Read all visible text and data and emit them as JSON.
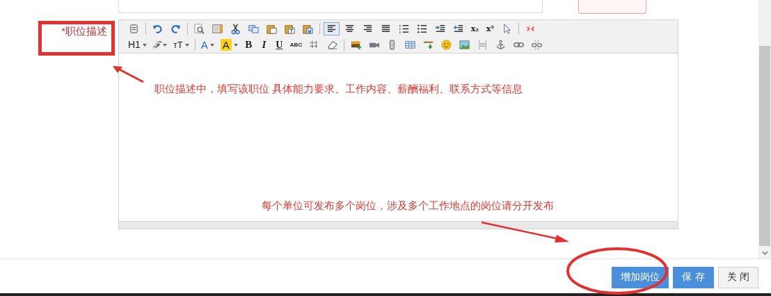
{
  "form": {
    "label": "*职位描述",
    "editor": {
      "toolbar": [
        [
          {
            "kind": "icon",
            "active": false
          },
          {
            "kind": "separator"
          },
          {
            "kind": "icon",
            "active": false
          },
          {
            "kind": "icon",
            "active": false
          },
          {
            "kind": "separator"
          },
          {
            "kind": "icon",
            "active": false
          },
          {
            "kind": "icon",
            "active": false
          },
          {
            "kind": "icon",
            "active": false
          },
          {
            "kind": "icon",
            "active": false
          },
          {
            "kind": "icon",
            "active": false
          },
          {
            "kind": "icon",
            "active": false
          },
          {
            "kind": "icon",
            "active": false
          },
          {
            "kind": "separator"
          },
          {
            "kind": "icon",
            "active": true
          },
          {
            "kind": "icon",
            "active": false
          },
          {
            "kind": "icon",
            "active": false
          },
          {
            "kind": "icon",
            "active": false
          },
          {
            "kind": "icon",
            "active": false
          },
          {
            "kind": "icon",
            "active": false
          },
          {
            "kind": "icon",
            "active": false
          },
          {
            "kind": "icon",
            "active": false
          },
          {
            "kind": "text",
            "label": "x₂",
            "active": false
          },
          {
            "kind": "text",
            "label": "x²",
            "active": false
          },
          {
            "kind": "icon",
            "active": false
          },
          {
            "kind": "separator"
          },
          {
            "kind": "icon",
            "active": false
          }
        ],
        [
          {
            "kind": "text",
            "label": "H1",
            "dropdown": true,
            "active": false
          },
          {
            "kind": "text",
            "label": "ℱ",
            "dropdown": true,
            "active": false
          },
          {
            "kind": "text",
            "label": "ᴛT",
            "dropdown": true,
            "active": false
          },
          {
            "kind": "separator"
          },
          {
            "kind": "text",
            "label": "A",
            "dropdown": true,
            "active": false
          },
          {
            "kind": "text",
            "label": "A",
            "dropdown": true,
            "active": false
          },
          {
            "kind": "text",
            "label": "B",
            "active": false
          },
          {
            "kind": "text",
            "label": "I",
            "active": false
          },
          {
            "kind": "text",
            "label": "U",
            "active": false
          },
          {
            "kind": "text",
            "label": "ABC",
            "active": false
          },
          {
            "kind": "icon",
            "active": false
          },
          {
            "kind": "icon",
            "active": false
          },
          {
            "kind": "separator"
          },
          {
            "kind": "icon",
            "active": false
          },
          {
            "kind": "icon",
            "active": false
          },
          {
            "kind": "icon",
            "active": false
          },
          {
            "kind": "icon",
            "active": false
          },
          {
            "kind": "icon",
            "active": false
          },
          {
            "kind": "icon",
            "active": false
          },
          {
            "kind": "icon",
            "active": false
          },
          {
            "kind": "icon",
            "active": false
          },
          {
            "kind": "icon",
            "active": false
          },
          {
            "kind": "icon",
            "active": false
          },
          {
            "kind": "icon",
            "active": false
          }
        ]
      ]
    }
  },
  "buttons": [
    {
      "label": "增加岗位",
      "kind": "primary"
    },
    {
      "label": "保 存",
      "kind": "primary"
    },
    {
      "label": "关 闭",
      "kind": "default"
    }
  ],
  "annotations": {
    "notes": [
      "职位描述中，填写该职位 具体能力要求、工作内容、薪酬福利、联系方式等信息",
      "每个单位可发布多个岗位，涉及多个工作地点的岗位请分开发布"
    ]
  }
}
